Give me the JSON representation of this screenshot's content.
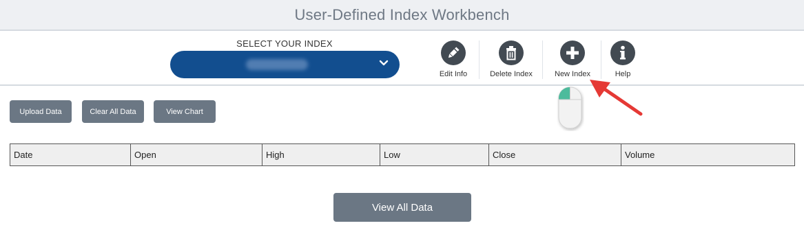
{
  "header": {
    "title": "User-Defined Index Workbench"
  },
  "index_select": {
    "label": "SELECT YOUR INDEX",
    "value": ""
  },
  "tools": [
    {
      "label": "Edit Info",
      "icon": "pencil-icon"
    },
    {
      "label": "Delete Index",
      "icon": "trash-icon"
    },
    {
      "label": "New Index",
      "icon": "plus-icon"
    },
    {
      "label": "Help",
      "icon": "info-icon"
    }
  ],
  "actions": {
    "upload": "Upload Data",
    "clear": "Clear All Data",
    "chart": "View Chart"
  },
  "table": {
    "columns": [
      "Date",
      "Open",
      "High",
      "Low",
      "Close",
      "Volume"
    ]
  },
  "footer": {
    "view_all": "View All Data"
  },
  "colors": {
    "accent_blue": "#124e8f",
    "button_gray": "#6b7784",
    "icon_dark": "#424a52",
    "arrow_red": "#e53935"
  }
}
